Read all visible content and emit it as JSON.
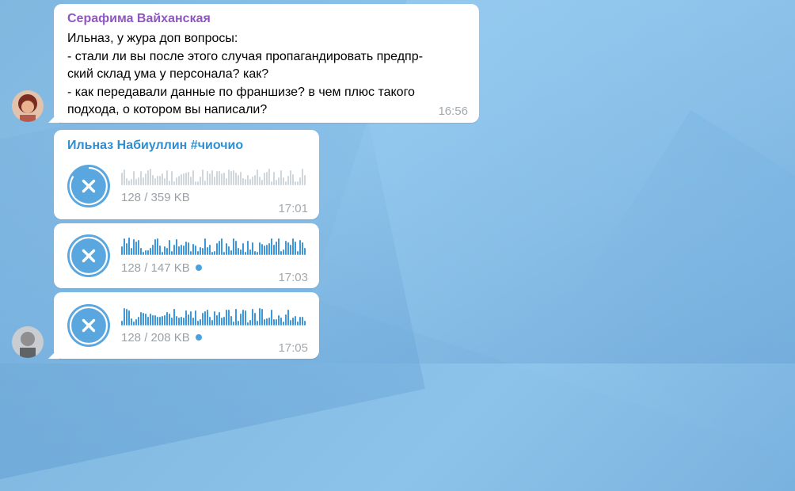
{
  "colors": {
    "sender_1": "#9057c0",
    "sender_2": "#2d8ed1",
    "accent": "#5aa7e0",
    "wave_unplayed": "#3d97d8",
    "wave_pending": "#cfd6dc",
    "unread_dot": "#4aa1df"
  },
  "messages": [
    {
      "sender": "Серафима Вайханская",
      "text": "Ильназ, у жура доп вопросы:\n-  стали ли вы после этого случая пропагандировать предпр-\nский склад ума у персонала? как?\n- как передавали данные по франшизе? в чем плюс такого\nподхода, о котором вы написали?",
      "time": "16:56",
      "avatar": "female-avatar"
    }
  ],
  "voice_group": {
    "sender": "Ильназ Набиуллин #чиочио",
    "avatar": "male-avatar",
    "items": [
      {
        "size": "128 / 359 KB",
        "time": "17:01",
        "unread": false,
        "loading": true,
        "button_icon": "cancel-download-icon"
      },
      {
        "size": "128 / 147 KB",
        "time": "17:03",
        "unread": true,
        "loading": false,
        "button_icon": "cancel-download-icon"
      },
      {
        "size": "128 / 208 KB",
        "time": "17:05",
        "unread": true,
        "loading": false,
        "button_icon": "cancel-download-icon"
      }
    ]
  }
}
